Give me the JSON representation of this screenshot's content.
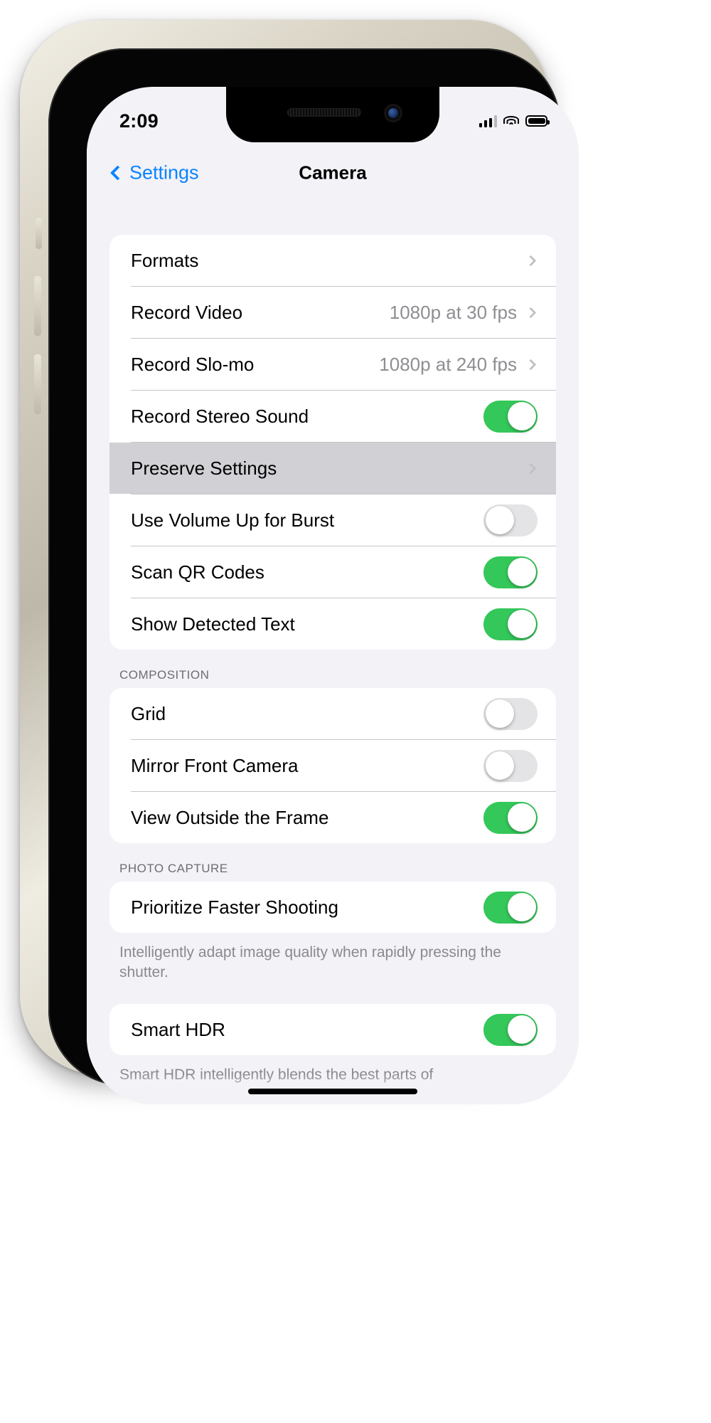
{
  "status_bar": {
    "time": "2:09",
    "signal_icon": "cellular-bars-icon",
    "wifi_icon": "wifi-icon",
    "battery_icon": "battery-icon"
  },
  "nav": {
    "back_label": "Settings",
    "back_icon": "chevron-left-icon",
    "title": "Camera"
  },
  "colors": {
    "accent": "#0a84ff",
    "toggle_on": "#34c759",
    "toggle_off": "#e4e4e6",
    "selected_row": "#d0d0d5",
    "group_bg": "#f2f2f7",
    "secondary_text": "#8e8e93"
  },
  "sections": [
    {
      "header": "",
      "rows": [
        {
          "label": "Formats",
          "type": "disclosure",
          "value": "",
          "selected": false
        },
        {
          "label": "Record Video",
          "type": "disclosure",
          "value": "1080p at 30 fps",
          "selected": false
        },
        {
          "label": "Record Slo-mo",
          "type": "disclosure",
          "value": "1080p at 240 fps",
          "selected": false
        },
        {
          "label": "Record Stereo Sound",
          "type": "toggle",
          "on": true,
          "selected": false
        },
        {
          "label": "Preserve Settings",
          "type": "disclosure",
          "value": "",
          "selected": true
        },
        {
          "label": "Use Volume Up for Burst",
          "type": "toggle",
          "on": false,
          "selected": false
        },
        {
          "label": "Scan QR Codes",
          "type": "toggle",
          "on": true,
          "selected": false
        },
        {
          "label": "Show Detected Text",
          "type": "toggle",
          "on": true,
          "selected": false
        }
      ],
      "footer": ""
    },
    {
      "header": "COMPOSITION",
      "rows": [
        {
          "label": "Grid",
          "type": "toggle",
          "on": false,
          "selected": false
        },
        {
          "label": "Mirror Front Camera",
          "type": "toggle",
          "on": false,
          "selected": false
        },
        {
          "label": "View Outside the Frame",
          "type": "toggle",
          "on": true,
          "selected": false
        }
      ],
      "footer": ""
    },
    {
      "header": "PHOTO CAPTURE",
      "rows": [
        {
          "label": "Prioritize Faster Shooting",
          "type": "toggle",
          "on": true,
          "selected": false
        }
      ],
      "footer": "Intelligently adapt image quality when rapidly pressing the shutter."
    },
    {
      "header": "",
      "rows": [
        {
          "label": "Smart HDR",
          "type": "toggle",
          "on": true,
          "selected": false
        }
      ],
      "footer": "Smart HDR intelligently blends the best parts of"
    }
  ]
}
